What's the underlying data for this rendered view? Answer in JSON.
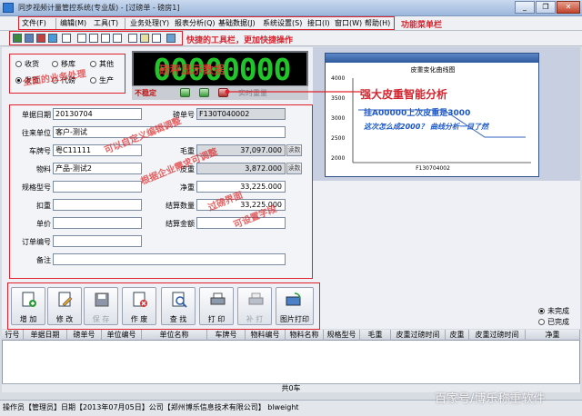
{
  "window": {
    "title": "同步视频计量管控系统(专业版) - [过磅单 - 磅房1]",
    "controls": {
      "minimize": "_",
      "restore": "❐",
      "close": "✕"
    }
  },
  "menu": {
    "items": [
      "文件(F)",
      "编辑(M)",
      "工具(T)",
      "业务处理(Y)",
      "报表分析(Q)",
      "基础数据(J)",
      "系统设置(S)",
      "接口(I)",
      "窗口(W)",
      "帮助(H)"
    ],
    "annotation": "功能菜单栏"
  },
  "toolbar": {
    "annotation": "快捷的工具栏，更加快捷操作"
  },
  "business_radios": {
    "options": [
      "收货",
      "移库",
      "其他",
      "发货",
      "代磅",
      "生产"
    ],
    "selected": "发货",
    "annotation": "全面的业务处理"
  },
  "weight_display": {
    "value": "00000000",
    "overlay": "磅秤显示数据",
    "status": "不稳定",
    "side_text": "实时重量"
  },
  "chart_popup": {
    "title": "皮重变化曲线图",
    "annotation": "强大皮重智能分析",
    "message_line1": "挂A00000上次皮重是3000",
    "message_line2": "这次怎么成2000？ 曲线分析一目了然",
    "xlabel": "F130704002",
    "ylabels": [
      "4000",
      "3500",
      "3000",
      "2500",
      "2000"
    ]
  },
  "form": {
    "fields": {
      "date_label": "单据日期",
      "date_value": "20130704",
      "ticket_label": "磅单号",
      "ticket_value": "F130T040002",
      "unit_label": "往来单位",
      "unit_value": "客户-测试",
      "plate_label": "车牌号",
      "plate_value": "粤C11111",
      "gross_label": "毛重",
      "gross_value": "37,097.000",
      "gross_btn": "读数",
      "goods_label": "物料",
      "goods_value": "产品-测试2",
      "tare_label": "皮重",
      "tare_value": "3,872.000",
      "tare_btn": "读数",
      "spec_label": "规格型号",
      "net_label": "净重",
      "net_value": "33,225.000",
      "deduct_label": "扣重",
      "settle_label": "结算数量",
      "settle_value": "33,225.000",
      "price_label": "单价",
      "amount_label": "结算金额",
      "order_label": "订单编号",
      "remark_label": "备注"
    },
    "annotation_line1": "可以自定义编辑调整",
    "annotation_line2": "根据企业需求可调整",
    "annotation_line3": "过磅界面",
    "annotation_line4": "可设置字段"
  },
  "actions": [
    {
      "label": "增 加",
      "icon": "add-doc-icon",
      "enabled": true
    },
    {
      "label": "修 改",
      "icon": "edit-doc-icon",
      "enabled": true
    },
    {
      "label": "保 存",
      "icon": "save-icon",
      "enabled": false
    },
    {
      "label": "作 废",
      "icon": "void-doc-icon",
      "enabled": true
    },
    {
      "label": "查 找",
      "icon": "find-icon",
      "enabled": true
    },
    {
      "label": "打 印",
      "icon": "print-icon",
      "enabled": true
    },
    {
      "label": "补 打",
      "icon": "reprint-icon",
      "enabled": false
    },
    {
      "label": "图片打印",
      "icon": "image-print-icon",
      "enabled": true
    }
  ],
  "filter_radios": {
    "options": [
      "未完成",
      "已完成"
    ],
    "selected": "未完成"
  },
  "grid": {
    "columns": [
      "行号",
      "单据日期",
      "磅单号",
      "单位编号",
      "单位名称",
      "车牌号",
      "物料编号",
      "物料名称",
      "规格型号",
      "毛重",
      "皮重过磅时间",
      "皮重",
      "皮重过磅时间",
      "净重"
    ],
    "total": "共0车"
  },
  "status": {
    "text": "操作员【管理员】日期【2013年07月05日】公司【郑州博乐信息技术有限公司】  blweight"
  },
  "watermark": "百家号/博乐称重软件",
  "colors": {
    "annotation": "#d4252f",
    "lcd_green": "#21c52b",
    "outline": "#e0202a"
  }
}
